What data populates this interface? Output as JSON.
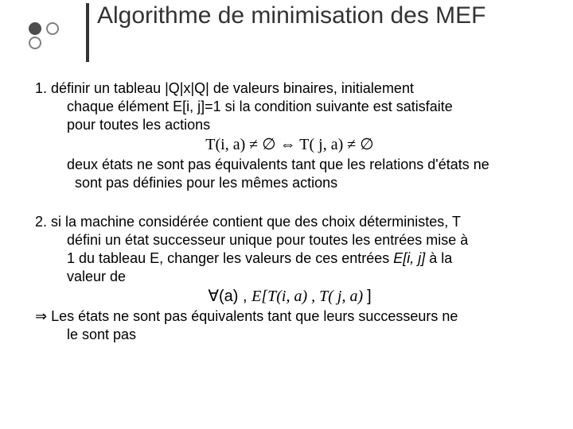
{
  "title": "Algorithme de minimisation des MEF",
  "step1": {
    "lead": "1. définir un tableau |Q|x|Q| de valeurs binaires, initialement",
    "line2": "chaque élément E[i, j]=1 si la condition suivante est satisfaite",
    "line3": "pour toutes les actions",
    "formula": "T(i, a) ≠ ∅ ⇔ T( j, a) ≠ ∅",
    "expl1": "deux états ne sont pas équivalents tant que les relations d'états ne",
    "expl2": "sont pas définies pour les mêmes actions"
  },
  "step2": {
    "lead": "2. si la machine considérée contient que des choix déterministes, T",
    "line2": "défini un état successeur unique pour toutes les entrées mise à",
    "line3a": "1 du tableau E, changer les valeurs de ces entrées",
    "line3i": "E[i, j]",
    "line3b": " à la",
    "line4": "valeur de",
    "formula_left": "∀(a) , ",
    "formula_mid": "E[T(i, a) , T( j, a) ",
    "formula_right": "]",
    "arrow": "⇒ ",
    "concl1": "Les états ne sont pas équivalents tant que leurs successeurs ne",
    "concl2": "le sont pas"
  }
}
